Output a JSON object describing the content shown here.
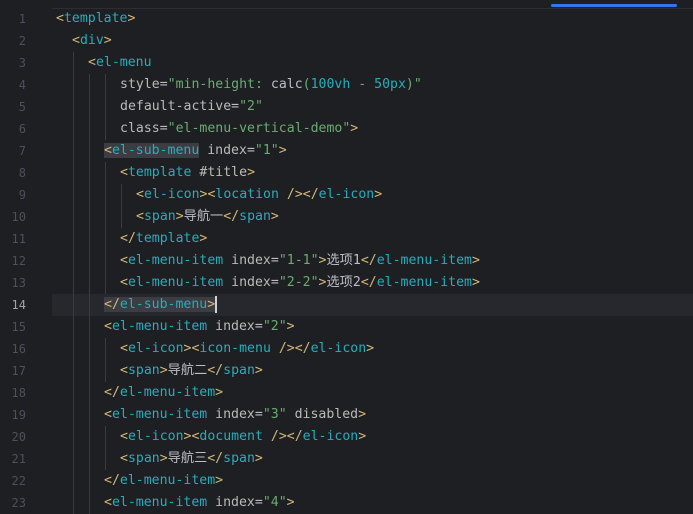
{
  "editor": {
    "current_line": 14,
    "colors": {
      "background": "#1e1f22",
      "tag_bracket": "#d5b778",
      "tag_name": "#2aacb8",
      "attribute": "#bababa",
      "string": "#6aab73",
      "text": "#bcbec4",
      "line_number": "#4b5059",
      "scroll_thumb": "#3574f0"
    },
    "lines": [
      {
        "n": "1",
        "indent": 0,
        "tokens": [
          [
            "tag",
            "<"
          ],
          [
            "tagname",
            "template"
          ],
          [
            "tag",
            ">"
          ]
        ]
      },
      {
        "n": "2",
        "indent": 1,
        "tokens": [
          [
            "tag",
            "<"
          ],
          [
            "tagname",
            "div"
          ],
          [
            "tag",
            ">"
          ]
        ]
      },
      {
        "n": "3",
        "indent": 2,
        "tokens": [
          [
            "tag",
            "<"
          ],
          [
            "tagname",
            "el-menu"
          ]
        ]
      },
      {
        "n": "4",
        "indent": 4,
        "tokens": [
          [
            "attr",
            "style"
          ],
          [
            "txt",
            "="
          ],
          [
            "str",
            "\"min-height: "
          ],
          [
            "cssval",
            "calc"
          ],
          [
            "str",
            "("
          ],
          [
            "num",
            "100vh"
          ],
          [
            "str",
            " - "
          ],
          [
            "num",
            "50px"
          ],
          [
            "str",
            ")\""
          ]
        ]
      },
      {
        "n": "5",
        "indent": 4,
        "tokens": [
          [
            "attr",
            "default-active"
          ],
          [
            "txt",
            "="
          ],
          [
            "str",
            "\"2\""
          ]
        ]
      },
      {
        "n": "6",
        "indent": 4,
        "tokens": [
          [
            "attr",
            "class"
          ],
          [
            "txt",
            "="
          ],
          [
            "str",
            "\"el-menu-vertical-demo\""
          ],
          [
            "tag",
            ">"
          ]
        ]
      },
      {
        "n": "7",
        "indent": 3,
        "tokens": [
          [
            "tag hl",
            "<"
          ],
          [
            "tagname hl",
            "el-sub-menu"
          ],
          [
            "attr",
            " index"
          ],
          [
            "txt",
            "="
          ],
          [
            "str",
            "\"1\""
          ],
          [
            "tag",
            ">"
          ]
        ]
      },
      {
        "n": "8",
        "indent": 4,
        "tokens": [
          [
            "tag",
            "<"
          ],
          [
            "tagname",
            "template"
          ],
          [
            "attr",
            " #title"
          ],
          [
            "tag",
            ">"
          ]
        ]
      },
      {
        "n": "9",
        "indent": 5,
        "tokens": [
          [
            "tag",
            "<"
          ],
          [
            "tagname",
            "el-icon"
          ],
          [
            "tag",
            "><"
          ],
          [
            "tagname",
            "location"
          ],
          [
            "tag",
            " /></"
          ],
          [
            "tagname",
            "el-icon"
          ],
          [
            "tag",
            ">"
          ]
        ]
      },
      {
        "n": "10",
        "indent": 5,
        "tokens": [
          [
            "tag",
            "<"
          ],
          [
            "tagname",
            "span"
          ],
          [
            "tag",
            ">"
          ],
          [
            "txt",
            "导航一"
          ],
          [
            "tag",
            "</"
          ],
          [
            "tagname",
            "span"
          ],
          [
            "tag",
            ">"
          ]
        ]
      },
      {
        "n": "11",
        "indent": 4,
        "tokens": [
          [
            "tag",
            "</"
          ],
          [
            "tagname",
            "template"
          ],
          [
            "tag",
            ">"
          ]
        ]
      },
      {
        "n": "12",
        "indent": 4,
        "tokens": [
          [
            "tag",
            "<"
          ],
          [
            "tagname",
            "el-menu-item"
          ],
          [
            "attr",
            " index"
          ],
          [
            "txt",
            "="
          ],
          [
            "str",
            "\"1-1\""
          ],
          [
            "tag",
            ">"
          ],
          [
            "txt",
            "选项1"
          ],
          [
            "tag",
            "</"
          ],
          [
            "tagname",
            "el-menu-item"
          ],
          [
            "tag",
            ">"
          ]
        ]
      },
      {
        "n": "13",
        "indent": 4,
        "tokens": [
          [
            "tag",
            "<"
          ],
          [
            "tagname",
            "el-menu-item"
          ],
          [
            "attr",
            " index"
          ],
          [
            "txt",
            "="
          ],
          [
            "str",
            "\"2-2\""
          ],
          [
            "tag",
            ">"
          ],
          [
            "txt",
            "选项2"
          ],
          [
            "tag",
            "</"
          ],
          [
            "tagname",
            "el-menu-item"
          ],
          [
            "tag",
            ">"
          ]
        ]
      },
      {
        "n": "14",
        "indent": 3,
        "tokens": [
          [
            "tag hl",
            "</"
          ],
          [
            "tagname hl",
            "el-sub-menu"
          ],
          [
            "tag hl",
            ">"
          ]
        ],
        "caret": true
      },
      {
        "n": "15",
        "indent": 3,
        "tokens": [
          [
            "tag",
            "<"
          ],
          [
            "tagname",
            "el-menu-item"
          ],
          [
            "attr",
            " index"
          ],
          [
            "txt",
            "="
          ],
          [
            "str",
            "\"2\""
          ],
          [
            "tag",
            ">"
          ]
        ]
      },
      {
        "n": "16",
        "indent": 4,
        "tokens": [
          [
            "tag",
            "<"
          ],
          [
            "tagname",
            "el-icon"
          ],
          [
            "tag",
            "><"
          ],
          [
            "tagname",
            "icon-menu"
          ],
          [
            "tag",
            " /></"
          ],
          [
            "tagname",
            "el-icon"
          ],
          [
            "tag",
            ">"
          ]
        ]
      },
      {
        "n": "17",
        "indent": 4,
        "tokens": [
          [
            "tag",
            "<"
          ],
          [
            "tagname",
            "span"
          ],
          [
            "tag",
            ">"
          ],
          [
            "txt",
            "导航二"
          ],
          [
            "tag",
            "</"
          ],
          [
            "tagname",
            "span"
          ],
          [
            "tag",
            ">"
          ]
        ]
      },
      {
        "n": "18",
        "indent": 3,
        "tokens": [
          [
            "tag",
            "</"
          ],
          [
            "tagname",
            "el-menu-item"
          ],
          [
            "tag",
            ">"
          ]
        ]
      },
      {
        "n": "19",
        "indent": 3,
        "tokens": [
          [
            "tag",
            "<"
          ],
          [
            "tagname",
            "el-menu-item"
          ],
          [
            "attr",
            " index"
          ],
          [
            "txt",
            "="
          ],
          [
            "str",
            "\"3\""
          ],
          [
            "attr",
            " disabled"
          ],
          [
            "tag",
            ">"
          ]
        ]
      },
      {
        "n": "20",
        "indent": 4,
        "tokens": [
          [
            "tag",
            "<"
          ],
          [
            "tagname",
            "el-icon"
          ],
          [
            "tag",
            "><"
          ],
          [
            "tagname",
            "document"
          ],
          [
            "tag",
            " /></"
          ],
          [
            "tagname",
            "el-icon"
          ],
          [
            "tag",
            ">"
          ]
        ]
      },
      {
        "n": "21",
        "indent": 4,
        "tokens": [
          [
            "tag",
            "<"
          ],
          [
            "tagname",
            "span"
          ],
          [
            "tag",
            ">"
          ],
          [
            "txt",
            "导航三"
          ],
          [
            "tag",
            "</"
          ],
          [
            "tagname",
            "span"
          ],
          [
            "tag",
            ">"
          ]
        ]
      },
      {
        "n": "22",
        "indent": 3,
        "tokens": [
          [
            "tag",
            "</"
          ],
          [
            "tagname",
            "el-menu-item"
          ],
          [
            "tag",
            ">"
          ]
        ]
      },
      {
        "n": "23",
        "indent": 3,
        "tokens": [
          [
            "tag",
            "<"
          ],
          [
            "tagname",
            "el-menu-item"
          ],
          [
            "attr",
            " index"
          ],
          [
            "txt",
            "="
          ],
          [
            "str",
            "\"4\""
          ],
          [
            "tag",
            ">"
          ]
        ]
      }
    ]
  }
}
